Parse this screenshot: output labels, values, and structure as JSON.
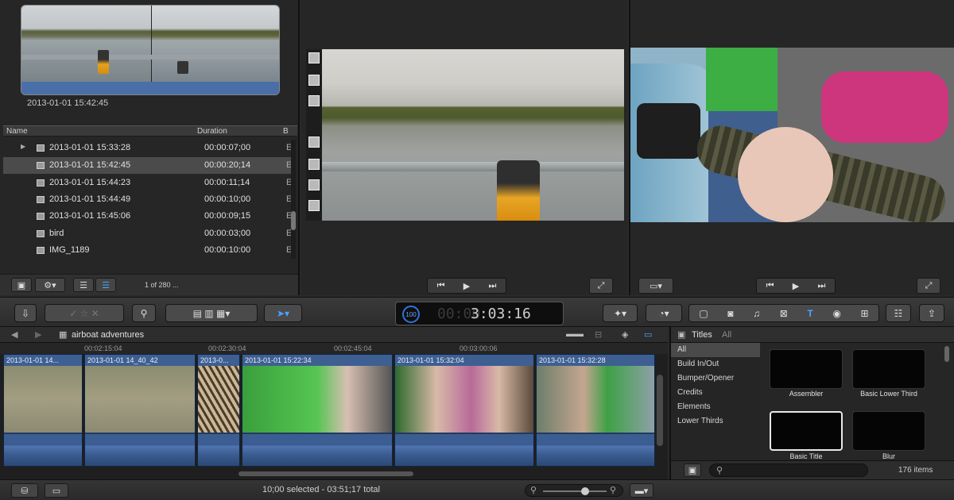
{
  "browser": {
    "timestamp": "2013-01-01 15:42:45",
    "columns": {
      "name": "Name",
      "duration": "Duration",
      "extra": "B"
    },
    "rows": [
      {
        "name": "2013-01-01 15:33:28",
        "duration": "00:00:07;00",
        "b": "E"
      },
      {
        "name": "2013-01-01 15:42:45",
        "duration": "00:00:20;14",
        "b": "E"
      },
      {
        "name": "2013-01-01 15:44:23",
        "duration": "00:00:11;14",
        "b": "E"
      },
      {
        "name": "2013-01-01 15:44:49",
        "duration": "00:00:10;00",
        "b": "E"
      },
      {
        "name": "2013-01-01 15:45:06",
        "duration": "00:00:09;15",
        "b": "E"
      },
      {
        "name": "bird",
        "duration": "00:00:03;00",
        "b": "E"
      },
      {
        "name": "IMG_1189",
        "duration": "00:00:10:00",
        "b": "E"
      }
    ],
    "item_count": "1 of 280 ..."
  },
  "toolbar": {
    "timecode": "3:03:16",
    "timecode_ghost": "00:00"
  },
  "timeline": {
    "project_name": "airboat adventures",
    "ruler": [
      "00:02:15:04",
      "00:02:30:04",
      "00:02:45:04",
      "00:03:00:06"
    ],
    "clips": [
      {
        "title": "2013-01-01 14..."
      },
      {
        "title": "2013-01-01 14_40_42"
      },
      {
        "title": "2013-0..."
      },
      {
        "title": "2013-01-01 15:22:34"
      },
      {
        "title": "2013-01-01 15:32:04"
      },
      {
        "title": "2013-01-01 15:32:28"
      }
    ]
  },
  "titles": {
    "header": "Titles",
    "filter": "All",
    "categories": [
      "All",
      "Build In/Out",
      "Bumper/Opener",
      "Credits",
      "Elements",
      "Lower Thirds"
    ],
    "tiles": [
      {
        "label": "Assembler"
      },
      {
        "label": "Basic Lower Third"
      },
      {
        "label": "Basic Title"
      },
      {
        "label": "Blur"
      }
    ],
    "count": "176 items"
  },
  "status": {
    "text": "10;00 selected - 03:51;17 total"
  },
  "colors": {
    "accent": "#2f73d8",
    "clip_blue": "#3d5f92",
    "selected_row": "#4b4b4b"
  }
}
